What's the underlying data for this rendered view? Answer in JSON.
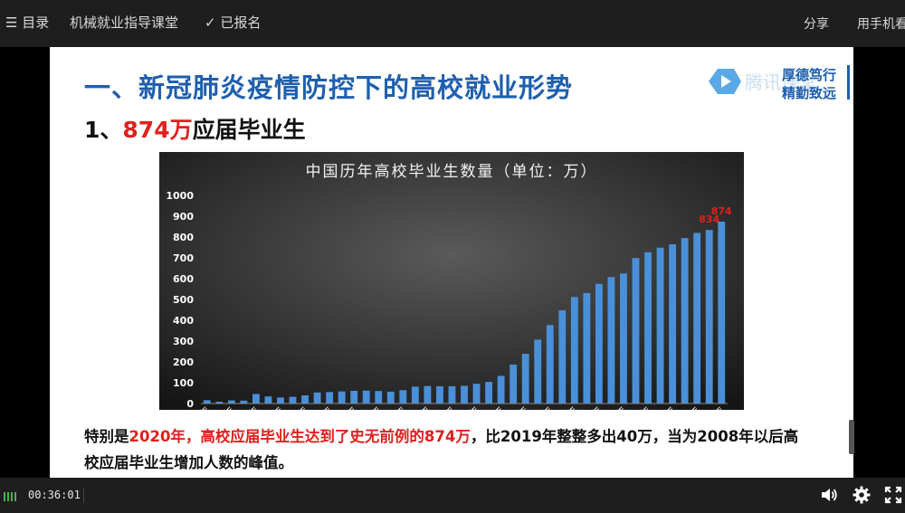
{
  "topbar": {
    "menu_label": "目录",
    "course_title": "机械就业指导课堂",
    "enrolled_label": "已报名",
    "share_label": "分享",
    "mobile_label": "用手机看"
  },
  "slide": {
    "title": "一、新冠肺炎疫情防控下的高校就业形势",
    "subtitle_prefix": "1、",
    "subtitle_highlight": "874万",
    "subtitle_suffix": "应届毕业生",
    "logo_text": "腾讯课堂",
    "motto_line1": "厚德笃行",
    "motto_line2": "精勤致远",
    "note_prefix": "特别是",
    "note_highlight": "2020年，高校应届毕业生达到了史无前例的874万",
    "note_suffix": "，比2019年整整多出40万，当为2008年以后高校应届毕业生增加人数的峰值。"
  },
  "player": {
    "time": "00:36:01"
  },
  "colors": {
    "title_blue": "#1f5fae",
    "highlight_red": "#e0201d",
    "bar_blue": "#4a90d9"
  },
  "chart_data": {
    "type": "bar",
    "title": "中国历年高校毕业生数量（单位：万）",
    "categories": [
      "1978年",
      "1979年",
      "1980年",
      "1981年",
      "1982年",
      "1983年",
      "1984年",
      "1985年",
      "1986年",
      "1987年",
      "1988年",
      "1989年",
      "1990年",
      "1991年",
      "1992年",
      "1993年",
      "1994年",
      "1995年",
      "1996年",
      "1997年",
      "1998年",
      "1999年",
      "2000年",
      "2001年",
      "2002年",
      "2003年",
      "2004年",
      "2005年",
      "2006年",
      "2007年",
      "2008年",
      "2009年",
      "2010年",
      "2011年",
      "2012年",
      "2013年",
      "2014年",
      "2015年",
      "2016年",
      "2017年",
      "2018年",
      "2019年",
      "2020年"
    ],
    "tick_labels": [
      "1978年",
      "1980年",
      "1982年",
      "1984年",
      "1986年",
      "1988年",
      "1990年",
      "1992年",
      "1994年",
      "1996年",
      "1998年",
      "2000年",
      "2002年",
      "2004年",
      "2006年",
      "2008年",
      "2010年",
      "2012年",
      "2014年",
      "2016年",
      "2018年",
      "2020年"
    ],
    "values": [
      16,
      9,
      15,
      14,
      46,
      34,
      29,
      32,
      39,
      53,
      55,
      58,
      61,
      62,
      60,
      57,
      64,
      81,
      84,
      83,
      83,
      85,
      95,
      104,
      133,
      187,
      239,
      307,
      377,
      448,
      512,
      531,
      575,
      608,
      625,
      699,
      727,
      749,
      765,
      795,
      820,
      834,
      874
    ],
    "data_labels": [
      {
        "category": "2019年",
        "value": "834"
      },
      {
        "category": "2020年",
        "value": "874"
      }
    ],
    "y_ticks": [
      "0",
      "100",
      "200",
      "300",
      "400",
      "500",
      "600",
      "700",
      "800",
      "900",
      "1000"
    ],
    "ylim": [
      0,
      1000
    ],
    "grid": false,
    "legend": "none"
  }
}
